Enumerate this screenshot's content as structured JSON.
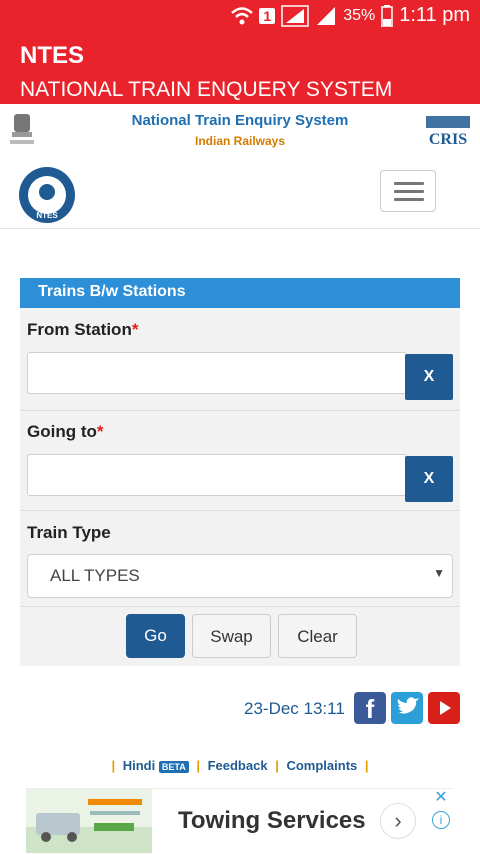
{
  "status_bar": {
    "wifi_icon": "wifi-icon",
    "sim_badge": "1",
    "battery": "35%",
    "time": "1:11 pm"
  },
  "app_bar": {
    "title": "NTES",
    "subtitle": "NATIONAL TRAIN ENQUERY SYSTEM",
    "background": "#e8232b"
  },
  "banner": {
    "title": "National Train Enquiry System",
    "subtitle": "Indian Railways",
    "logo_label": "CRIS"
  },
  "navbar": {
    "logo_label": "NTES",
    "menu_icon": "hamburger-icon"
  },
  "form": {
    "heading": "Trains B/w Stations",
    "from_label": "From Station",
    "from_value": "",
    "from_clear": "X",
    "to_label": "Going to",
    "to_value": "",
    "to_clear": "X",
    "required_mark": "*",
    "type_label": "Train Type",
    "type_value": "ALL TYPES",
    "buttons": {
      "go": "Go",
      "swap": "Swap",
      "clear": "Clear"
    },
    "accent": "#2c8fd7",
    "button_color": "#1f5a92"
  },
  "footer": {
    "datetime": "23-Dec 13:11",
    "social": [
      "facebook-icon",
      "twitter-icon",
      "youtube-icon"
    ],
    "links": {
      "hindi": "Hindi",
      "beta": "BETA",
      "feedback": "Feedback",
      "complaints": "Complaints"
    }
  },
  "ad": {
    "text": "Towing Services"
  }
}
